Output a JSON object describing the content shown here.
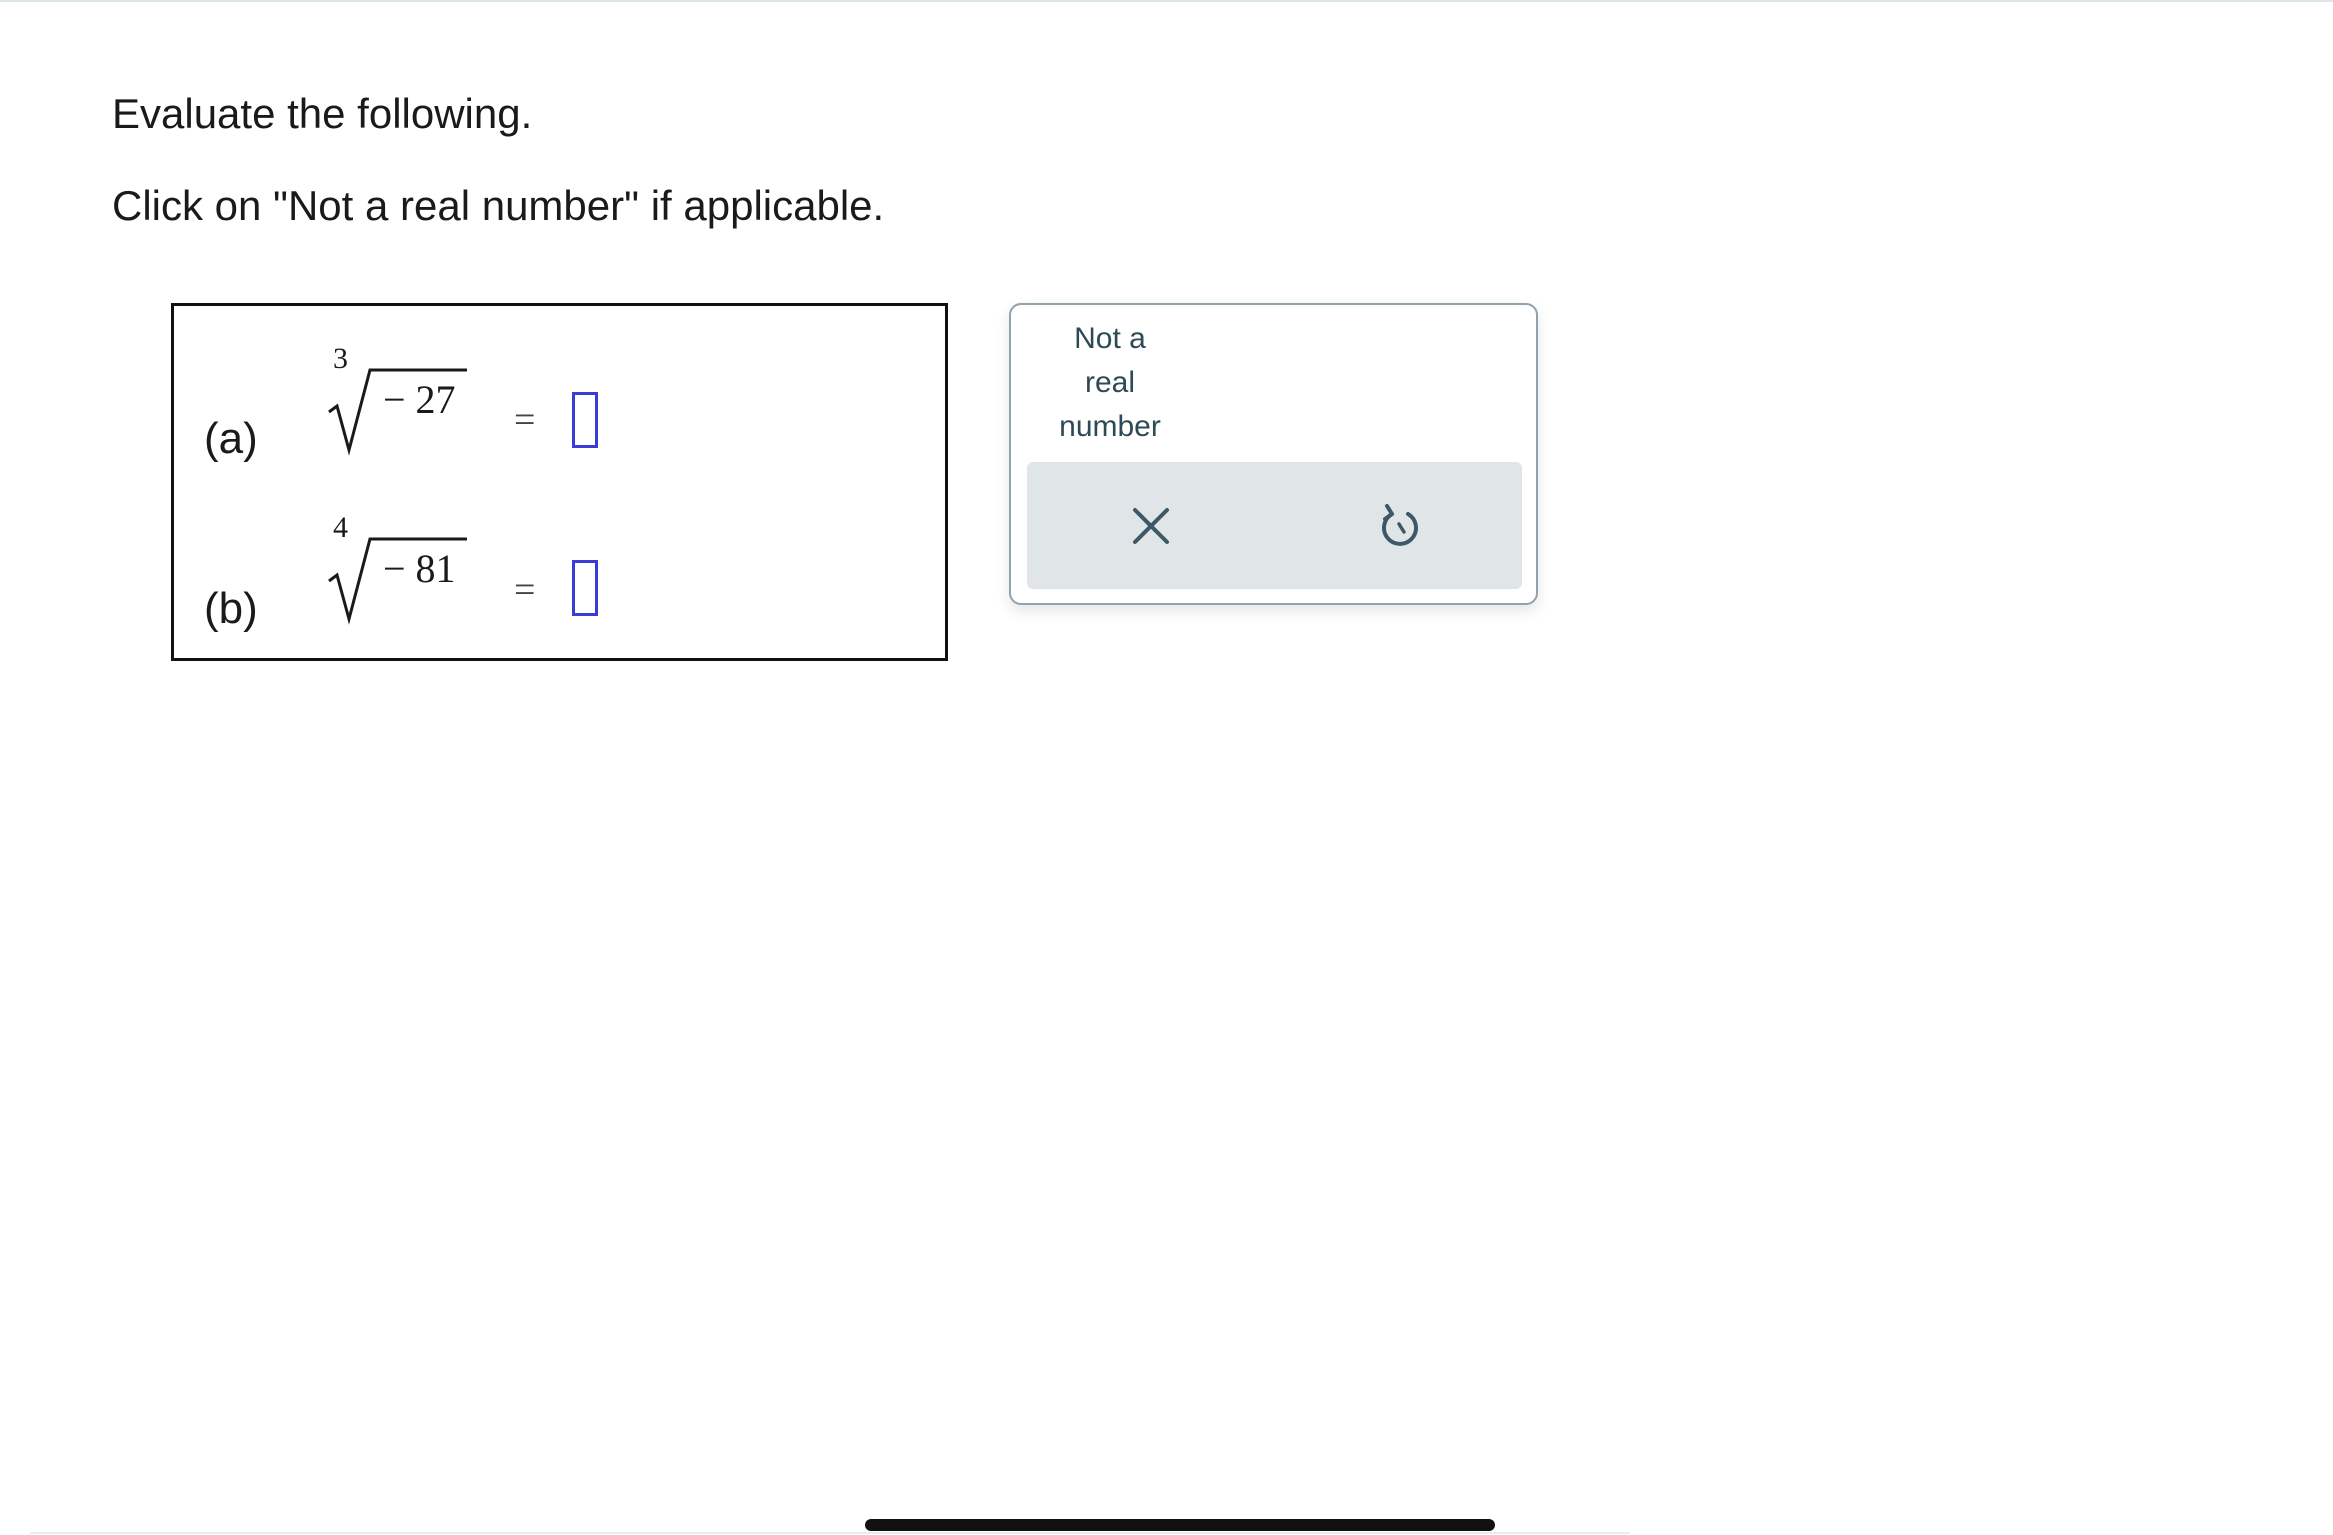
{
  "instructions": {
    "line1": "Evaluate the following.",
    "line2": "Click on \"Not a real number\" if applicable."
  },
  "problems": [
    {
      "label": "(a)",
      "index": "3",
      "radicand": "− 27",
      "equals": "=",
      "answer": ""
    },
    {
      "label": "(b)",
      "index": "4",
      "radicand": "− 81",
      "equals": "=",
      "answer": ""
    }
  ],
  "keypad": {
    "not_real_number_label": "Not a real number",
    "clear_icon": "close-icon",
    "undo_icon": "undo-icon"
  },
  "colors": {
    "input_border": "#3b3bd6",
    "keypad_text": "#2f4a57",
    "action_bar_bg": "#e0e6e8",
    "keypad_border": "#8fa3ad"
  }
}
